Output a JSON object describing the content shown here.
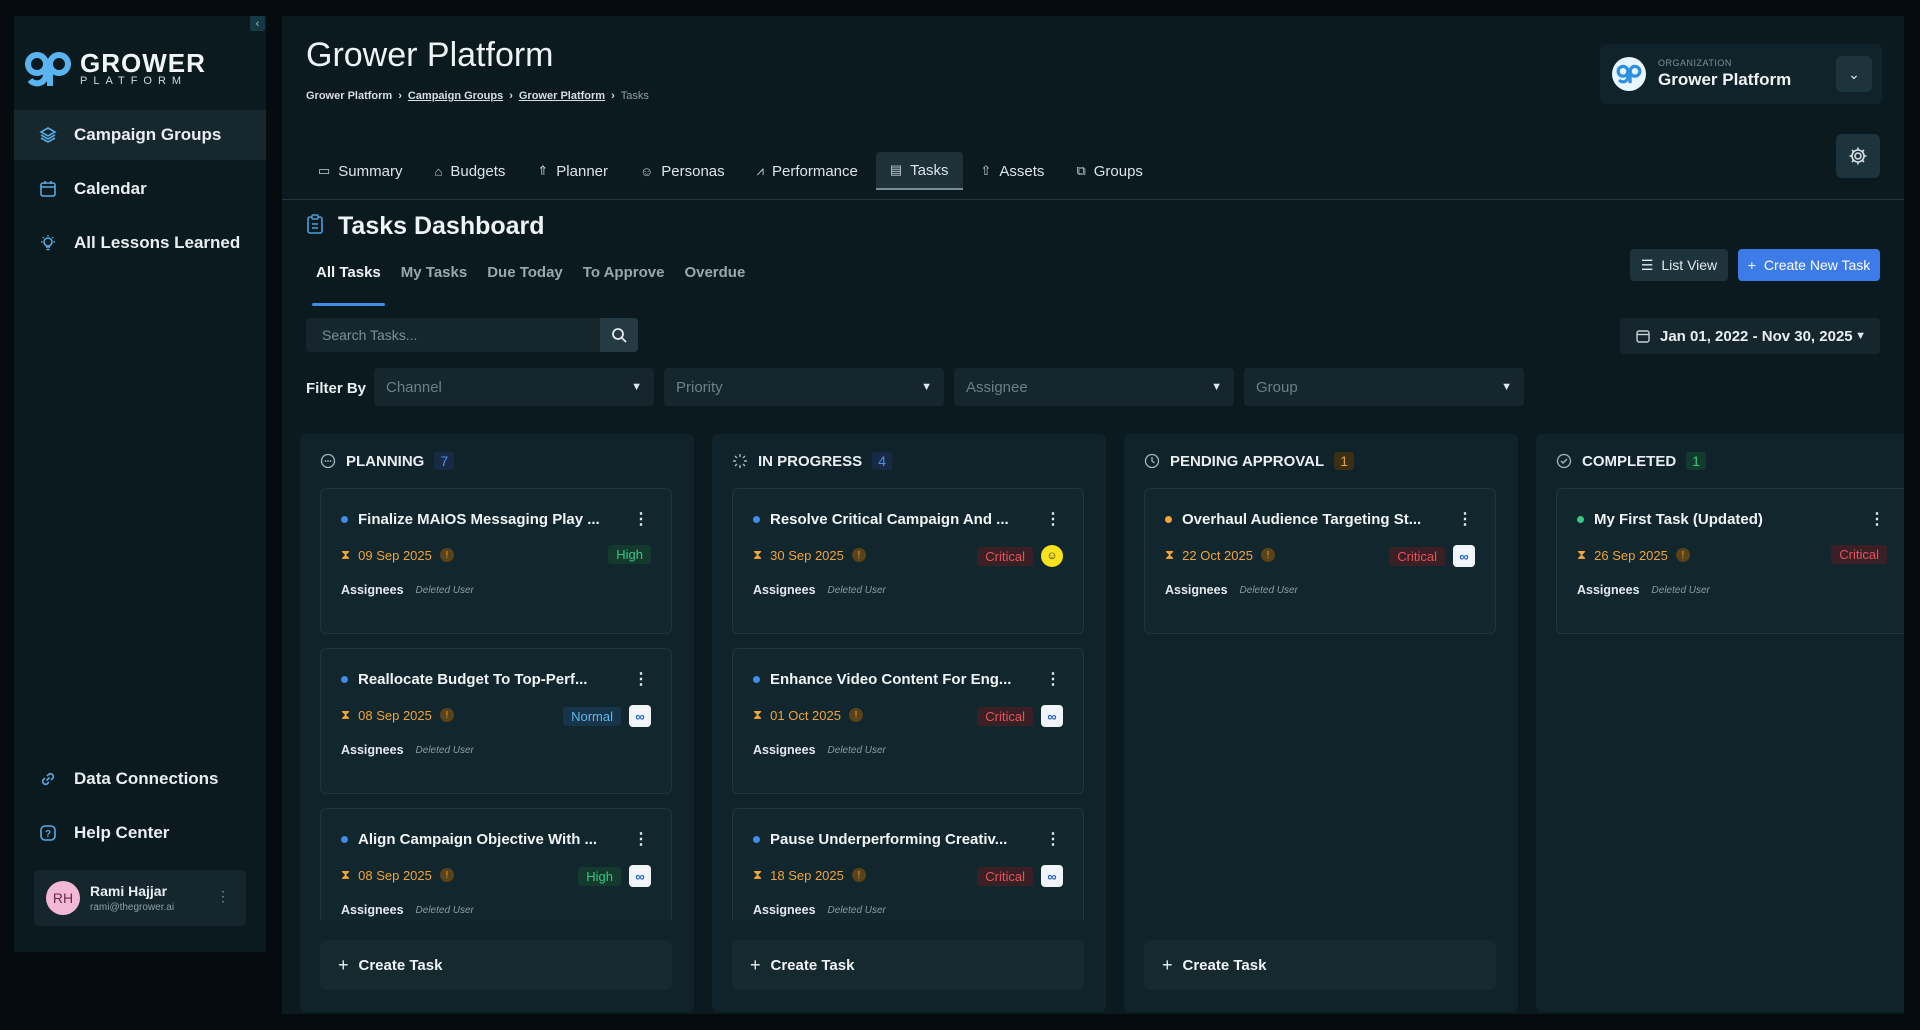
{
  "sidebar": {
    "logo": {
      "line1": "GROWER",
      "line2": "PLATFORM"
    },
    "nav": [
      {
        "label": "Campaign Groups",
        "icon": "layers-icon"
      },
      {
        "label": "Calendar",
        "icon": "calendar-icon"
      },
      {
        "label": "All Lessons Learned",
        "icon": "lightbulb-icon"
      }
    ],
    "bottom_nav": [
      {
        "label": "Data Connections",
        "icon": "link-icon"
      },
      {
        "label": "Help Center",
        "icon": "help-icon"
      }
    ],
    "user": {
      "initials": "RH",
      "name": "Rami Hajjar",
      "email": "rami@thegrower.ai"
    }
  },
  "header": {
    "title": "Grower Platform",
    "breadcrumb": [
      "Grower Platform",
      "Campaign Groups",
      "Grower Platform",
      "Tasks"
    ],
    "org": {
      "label": "ORGANIZATION",
      "name": "Grower Platform"
    }
  },
  "tabs": [
    "Summary",
    "Budgets",
    "Planner",
    "Personas",
    "Performance",
    "Tasks",
    "Assets",
    "Groups"
  ],
  "active_tab": "Tasks",
  "dashboard": {
    "title": "Tasks Dashboard",
    "subtabs": [
      "All Tasks",
      "My Tasks",
      "Due Today",
      "To Approve",
      "Overdue"
    ],
    "list_view": "List View",
    "create_new": "Create New Task",
    "search_placeholder": "Search Tasks...",
    "date_range": "Jan 01, 2022 - Nov 30, 2025",
    "filter_label": "Filter By",
    "filters": [
      "Channel",
      "Priority",
      "Assignee",
      "Group"
    ]
  },
  "colors": {
    "accent": "#3d7be8",
    "planning": "#3e8ee6",
    "pending": "#f1a43a",
    "completed": "#36c982",
    "critical": "#e4545d"
  },
  "columns": [
    {
      "title": "PLANNING",
      "count": "7",
      "cards": [
        {
          "title": "Finalize MAIOS Messaging Play ...",
          "date": "09 Sep 2025",
          "priority": "High",
          "channel": "",
          "assignees_label": "Assignees",
          "assignee": "Deleted User"
        },
        {
          "title": "Reallocate Budget To Top-Perf...",
          "date": "08 Sep 2025",
          "priority": "Normal",
          "channel": "meta",
          "assignees_label": "Assignees",
          "assignee": "Deleted User"
        },
        {
          "title": "Align Campaign Objective With ...",
          "date": "08 Sep 2025",
          "priority": "High",
          "channel": "meta",
          "assignees_label": "Assignees",
          "assignee": "Deleted User"
        }
      ],
      "create": "Create Task"
    },
    {
      "title": "IN PROGRESS",
      "count": "4",
      "cards": [
        {
          "title": "Resolve Critical Campaign And ...",
          "date": "30 Sep 2025",
          "priority": "Critical",
          "channel": "snapchat",
          "assignees_label": "Assignees",
          "assignee": "Deleted User"
        },
        {
          "title": "Enhance Video Content For Eng...",
          "date": "01 Oct 2025",
          "priority": "Critical",
          "channel": "meta",
          "assignees_label": "Assignees",
          "assignee": "Deleted User"
        },
        {
          "title": "Pause Underperforming Creativ...",
          "date": "18 Sep 2025",
          "priority": "Critical",
          "channel": "meta",
          "assignees_label": "Assignees",
          "assignee": "Deleted User"
        }
      ],
      "create": "Create Task"
    },
    {
      "title": "PENDING APPROVAL",
      "count": "1",
      "cards": [
        {
          "title": "Overhaul Audience Targeting St...",
          "date": "22 Oct 2025",
          "priority": "Critical",
          "channel": "meta",
          "assignees_label": "Assignees",
          "assignee": "Deleted User"
        }
      ],
      "create": "Create Task"
    },
    {
      "title": "COMPLETED",
      "count": "1",
      "cards": [
        {
          "title": "My First Task (Updated)",
          "date": "26 Sep 2025",
          "priority": "Critical",
          "channel": "",
          "assignees_label": "Assignees",
          "assignee": "Deleted User"
        }
      ],
      "create": ""
    }
  ]
}
